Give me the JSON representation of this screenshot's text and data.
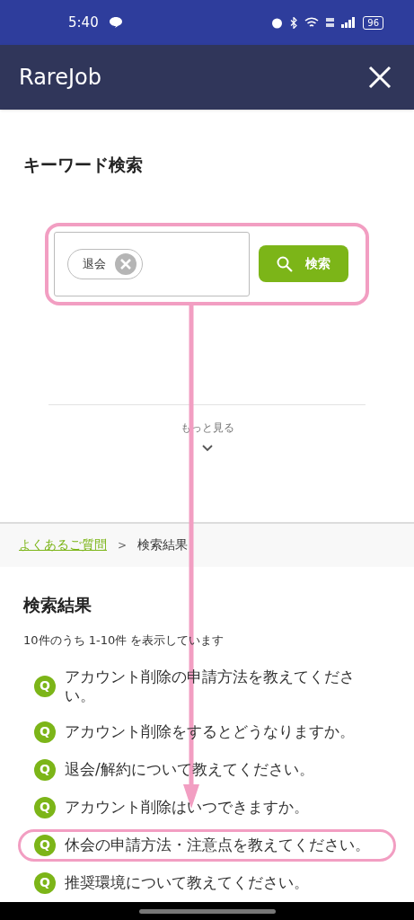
{
  "status_bar": {
    "time": "5:40",
    "battery": "96"
  },
  "header": {
    "title": "RareJob"
  },
  "keyword_search": {
    "title": "キーワード検索",
    "tags": [
      {
        "label": "退会"
      }
    ],
    "highlighted": true,
    "button": "検索",
    "more": "もっと見る"
  },
  "breadcrumb": [
    {
      "label": "よくあるご質問",
      "kind": "link"
    },
    {
      "label": "検索結果",
      "kind": "current"
    }
  ],
  "breadcrumb_separator": ">",
  "results": {
    "title": "検索結果",
    "summary": "10件のうち 1-10件 を表示しています",
    "items": [
      {
        "badge": "Q",
        "text": "アカウント削除の申請方法を教えてください。",
        "highlighted": false
      },
      {
        "badge": "Q",
        "text": "アカウント削除をするとどうなりますか。",
        "highlighted": false
      },
      {
        "badge": "Q",
        "text": "退会/解約について教えてください。",
        "highlighted": false
      },
      {
        "badge": "Q",
        "text": "アカウント削除はいつできますか。",
        "highlighted": false
      },
      {
        "badge": "Q",
        "text": "休会の申請方法・注意点を教えてください。",
        "highlighted": true
      },
      {
        "badge": "Q",
        "text": "推奨環境について教えてください。",
        "highlighted": false
      }
    ]
  },
  "annotation": {
    "arrow": true
  }
}
